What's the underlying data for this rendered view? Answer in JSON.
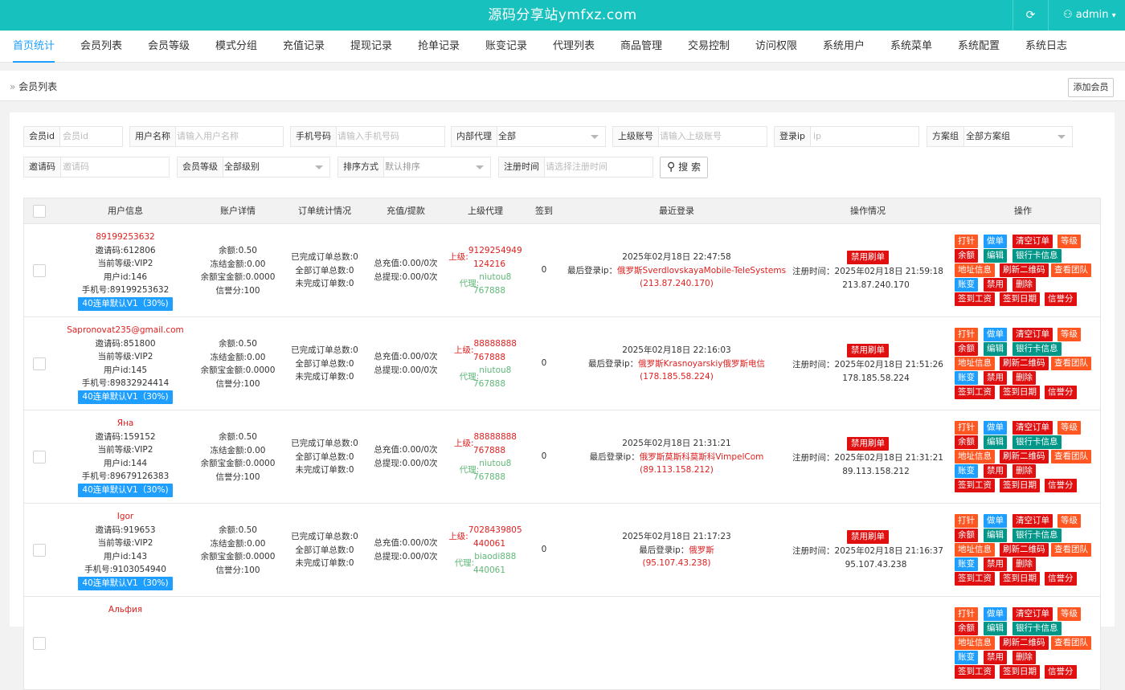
{
  "topbar": {
    "title": "源码分享站ymfxz.com",
    "refresh_icon": "⟳",
    "user_icon": "⚇",
    "user": "admin",
    "user_caret": "▾"
  },
  "nav": [
    "首页统计",
    "会员列表",
    "会员等级",
    "模式分组",
    "充值记录",
    "提现记录",
    "抢单记录",
    "账变记录",
    "代理列表",
    "商品管理",
    "交易控制",
    "访问权限",
    "系统用户",
    "系统菜单",
    "系统配置",
    "系统日志"
  ],
  "breadcrumb": {
    "icon": "»",
    "label": "会员列表"
  },
  "add_button": "添加会员",
  "filters": {
    "member_id": {
      "label": "会员id",
      "placeholder": "会员id"
    },
    "username": {
      "label": "用户名称",
      "placeholder": "请输入用户名称"
    },
    "phone": {
      "label": "手机号码",
      "placeholder": "请输入手机号码"
    },
    "agent": {
      "label": "内部代理",
      "value": "全部"
    },
    "parent": {
      "label": "上级账号",
      "placeholder": "请输入上级账号"
    },
    "login_ip": {
      "label": "登录ip",
      "placeholder": "ip"
    },
    "plan": {
      "label": "方案组",
      "value": "全部方案组"
    },
    "invite": {
      "label": "邀请码",
      "placeholder": "邀请码"
    },
    "level": {
      "label": "会员等级",
      "value": "全部级别"
    },
    "sort": {
      "label": "排序方式",
      "value": "默认排序"
    },
    "reg_time": {
      "label": "注册时间",
      "placeholder": "请选择注册时间"
    },
    "search_icon": "⚲",
    "search_label": "搜 索"
  },
  "table": {
    "headers": [
      "用户信息",
      "账户详情",
      "订单统计情况",
      "充值/提款",
      "上级代理",
      "签到",
      "最近登录",
      "操作情况",
      "操作"
    ],
    "ops": [
      "打针",
      "做单",
      "清空订单",
      "等级",
      "余额",
      "编辑",
      "银行卡信息",
      "地址信息",
      "刷新二维码",
      "查看团队",
      "账变",
      "禁用",
      "删除",
      "签到工资",
      "签到日期",
      "信誉分"
    ],
    "rows": [
      {
        "name": "89199253632",
        "invite": "邀请码:612806",
        "level": "当前等级:VIP2",
        "uid": "用户id:146",
        "phone": "手机号:89199253632",
        "plan": "40连单默认V1（30%)",
        "balance": "余额:0.50",
        "frozen": "冻结金额:0.00",
        "yeb": "余额宝金额:0.0000",
        "credit": "信誉分:100",
        "o1": "已完成订单总数:0",
        "o2": "全部订单总数:0",
        "o3": "未完成订单数:0",
        "recharge": "总充值:0.00/0次",
        "withdraw": "总提现:0.00/0次",
        "up_label": "上级:",
        "up1": "9129254949",
        "up2": "124216",
        "ag_label": "代理:",
        "ag1": "niutou8",
        "ag2": "767888",
        "sign": "0",
        "login_time": "2025年02月18日 22:47:58",
        "login_ip_label": "最后登录ip：",
        "login_loc": "俄罗斯SverdlovskayaMobile-TeleSystems",
        "login_ip": "(213.87.240.170)",
        "ban": "禁用刷单",
        "reg_label": "注册时间：",
        "reg_time": "2025年02月18日 21:59:18",
        "reg_ip": "213.87.240.170"
      },
      {
        "name": "Sapronovat235@gmail.com",
        "invite": "邀请码:851800",
        "level": "当前等级:VIP2",
        "uid": "用户id:145",
        "phone": "手机号:89832924414",
        "plan": "40连单默认V1（30%)",
        "balance": "余额:0.50",
        "frozen": "冻结金额:0.00",
        "yeb": "余额宝金额:0.0000",
        "credit": "信誉分:100",
        "o1": "已完成订单总数:0",
        "o2": "全部订单总数:0",
        "o3": "未完成订单数:0",
        "recharge": "总充值:0.00/0次",
        "withdraw": "总提现:0.00/0次",
        "up_label": "上级:",
        "up1": "88888888",
        "up2": "767888",
        "ag_label": "代理:",
        "ag1": "niutou8",
        "ag2": "767888",
        "sign": "0",
        "login_time": "2025年02月18日 22:16:03",
        "login_ip_label": "最后登录ip：",
        "login_loc": "俄罗斯Krasnoyarskiy俄罗斯电信",
        "login_ip": "(178.185.58.224)",
        "ban": "禁用刷单",
        "reg_label": "注册时间：",
        "reg_time": "2025年02月18日 21:51:26",
        "reg_ip": "178.185.58.224"
      },
      {
        "name": "Яна",
        "invite": "邀请码:159152",
        "level": "当前等级:VIP2",
        "uid": "用户id:144",
        "phone": "手机号:89679126383",
        "plan": "40连单默认V1（30%)",
        "balance": "余额:0.50",
        "frozen": "冻结金额:0.00",
        "yeb": "余额宝金额:0.0000",
        "credit": "信誉分:100",
        "o1": "已完成订单总数:0",
        "o2": "全部订单总数:0",
        "o3": "未完成订单数:0",
        "recharge": "总充值:0.00/0次",
        "withdraw": "总提现:0.00/0次",
        "up_label": "上级:",
        "up1": "88888888",
        "up2": "767888",
        "ag_label": "代理:",
        "ag1": "niutou8",
        "ag2": "767888",
        "sign": "0",
        "login_time": "2025年02月18日 21:31:21",
        "login_ip_label": "最后登录ip：",
        "login_loc": "俄罗斯莫斯科莫斯科VimpelCom",
        "login_ip": "(89.113.158.212)",
        "ban": "禁用刷单",
        "reg_label": "注册时间：",
        "reg_time": "2025年02月18日 21:31:21",
        "reg_ip": "89.113.158.212"
      },
      {
        "name": "Igor",
        "invite": "邀请码:919653",
        "level": "当前等级:VIP2",
        "uid": "用户id:143",
        "phone": "手机号:9103054940",
        "plan": "40连单默认V1（30%)",
        "balance": "余额:0.50",
        "frozen": "冻结金额:0.00",
        "yeb": "余额宝金额:0.0000",
        "credit": "信誉分:100",
        "o1": "已完成订单总数:0",
        "o2": "全部订单总数:0",
        "o3": "未完成订单数:0",
        "recharge": "总充值:0.00/0次",
        "withdraw": "总提现:0.00/0次",
        "up_label": "上级:",
        "up1": "7028439805",
        "up2": "440061",
        "ag_label": "代理:",
        "ag1": "biaodi888",
        "ag2": "440061",
        "sign": "0",
        "login_time": "2025年02月18日 21:17:23",
        "login_ip_label": "最后登录ip：",
        "login_loc": "俄罗斯",
        "login_ip": "(95.107.43.238)",
        "ban": "禁用刷单",
        "reg_label": "注册时间：",
        "reg_time": "2025年02月18日 21:16:37",
        "reg_ip": "95.107.43.238"
      },
      {
        "name": "Альфия"
      }
    ]
  }
}
